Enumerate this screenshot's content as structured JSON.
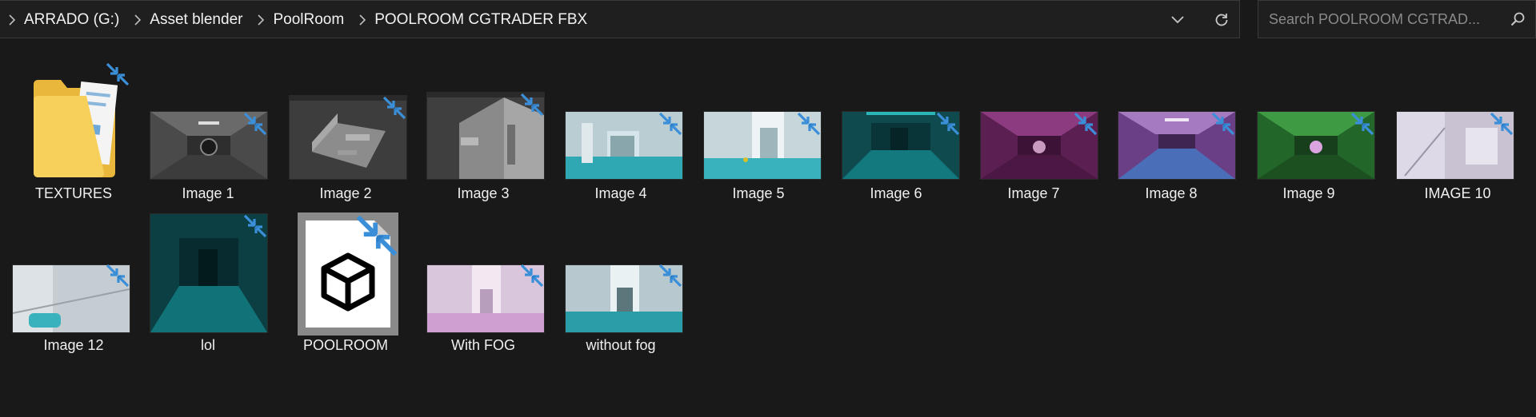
{
  "breadcrumb": [
    "ARRADO (G:)",
    "Asset blender",
    "PoolRoom",
    "POOLROOM CGTRADER FBX"
  ],
  "search": {
    "placeholder": "Search POOLROOM CGTRAD..."
  },
  "icons": {
    "breadcrumb_separator": "chevron-right-icon",
    "address_dropdown": "chevron-down-icon",
    "refresh": "refresh-icon",
    "search": "search-icon",
    "sync_status": "cloud-sync-arrows-icon",
    "folder": "folder-icon",
    "model_file": "3d-cube-icon"
  },
  "colors": {
    "background": "#191919",
    "sync_badge": "#3b8fd9",
    "text": "#f0f0f0"
  },
  "items": [
    {
      "name": "TEXTURES",
      "kind": "folder"
    },
    {
      "name": "Image 1",
      "kind": "image",
      "tint": "gray"
    },
    {
      "name": "Image 2",
      "kind": "image",
      "tint": "viewport"
    },
    {
      "name": "Image 3",
      "kind": "image",
      "tint": "viewport"
    },
    {
      "name": "Image 4",
      "kind": "image",
      "tint": "pool-light"
    },
    {
      "name": "Image 5",
      "kind": "image",
      "tint": "pool-light"
    },
    {
      "name": "Image 6",
      "kind": "image",
      "tint": "teal"
    },
    {
      "name": "Image 7",
      "kind": "image",
      "tint": "magenta"
    },
    {
      "name": "Image 8",
      "kind": "image",
      "tint": "purple"
    },
    {
      "name": "Image 9",
      "kind": "image",
      "tint": "green"
    },
    {
      "name": "IMAGE 10",
      "kind": "image",
      "tint": "pale"
    },
    {
      "name": "Image 12",
      "kind": "image",
      "tint": "pale"
    },
    {
      "name": "lol",
      "kind": "image",
      "tint": "teal-dark"
    },
    {
      "name": "POOLROOM",
      "kind": "model"
    },
    {
      "name": "With FOG",
      "kind": "image",
      "tint": "pink-fog"
    },
    {
      "name": "without fog",
      "kind": "image",
      "tint": "pool-light"
    }
  ]
}
